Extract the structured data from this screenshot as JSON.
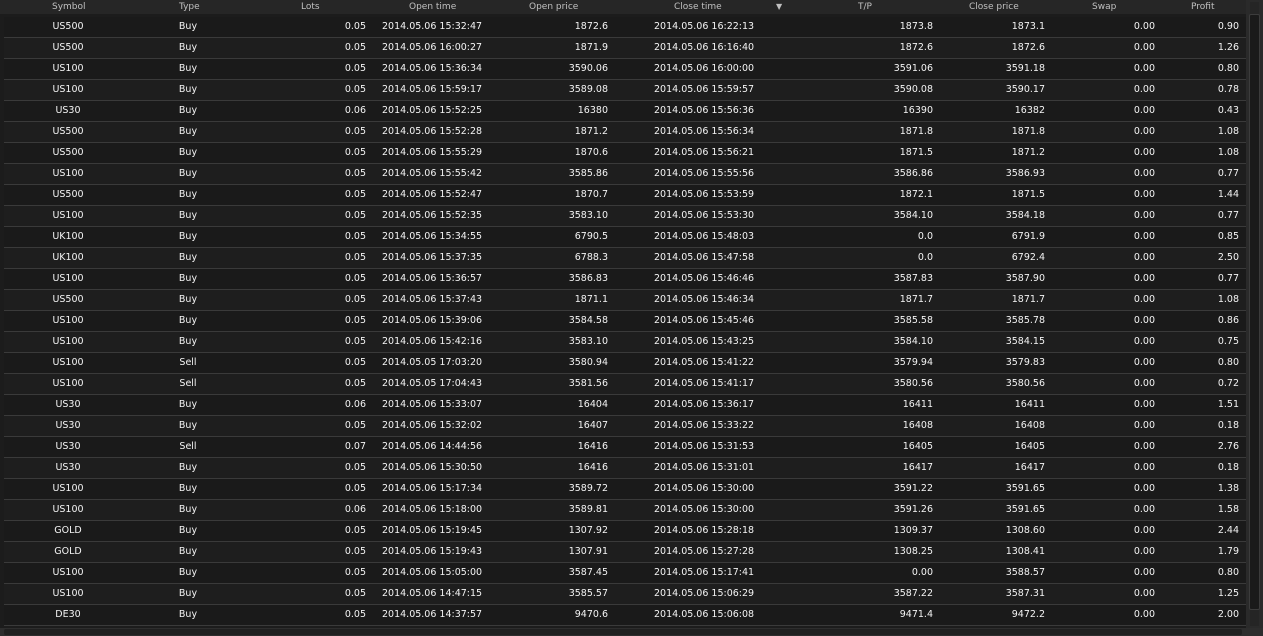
{
  "columns": {
    "symbol": "Symbol",
    "type": "Type",
    "lots": "Lots",
    "open_time": "Open time",
    "open_price": "Open price",
    "close_time": "Close time",
    "tp": "T/P",
    "close_price": "Close price",
    "swap": "Swap",
    "profit": "Profit"
  },
  "sort_indicator": "▼",
  "rows": [
    {
      "symbol": "US500",
      "type": "Buy",
      "lots": "0.05",
      "open_time": "2014.05.06 15:32:47",
      "open_price": "1872.6",
      "close_time": "2014.05.06 16:22:13",
      "tp": "1873.8",
      "close_price": "1873.1",
      "swap": "0.00",
      "profit": "0.90"
    },
    {
      "symbol": "US500",
      "type": "Buy",
      "lots": "0.05",
      "open_time": "2014.05.06 16:00:27",
      "open_price": "1871.9",
      "close_time": "2014.05.06 16:16:40",
      "tp": "1872.6",
      "close_price": "1872.6",
      "swap": "0.00",
      "profit": "1.26"
    },
    {
      "symbol": "US100",
      "type": "Buy",
      "lots": "0.05",
      "open_time": "2014.05.06 15:36:34",
      "open_price": "3590.06",
      "close_time": "2014.05.06 16:00:00",
      "tp": "3591.06",
      "close_price": "3591.18",
      "swap": "0.00",
      "profit": "0.80"
    },
    {
      "symbol": "US100",
      "type": "Buy",
      "lots": "0.05",
      "open_time": "2014.05.06 15:59:17",
      "open_price": "3589.08",
      "close_time": "2014.05.06 15:59:57",
      "tp": "3590.08",
      "close_price": "3590.17",
      "swap": "0.00",
      "profit": "0.78"
    },
    {
      "symbol": "US30",
      "type": "Buy",
      "lots": "0.06",
      "open_time": "2014.05.06 15:52:25",
      "open_price": "16380",
      "close_time": "2014.05.06 15:56:36",
      "tp": "16390",
      "close_price": "16382",
      "swap": "0.00",
      "profit": "0.43"
    },
    {
      "symbol": "US500",
      "type": "Buy",
      "lots": "0.05",
      "open_time": "2014.05.06 15:52:28",
      "open_price": "1871.2",
      "close_time": "2014.05.06 15:56:34",
      "tp": "1871.8",
      "close_price": "1871.8",
      "swap": "0.00",
      "profit": "1.08"
    },
    {
      "symbol": "US500",
      "type": "Buy",
      "lots": "0.05",
      "open_time": "2014.05.06 15:55:29",
      "open_price": "1870.6",
      "close_time": "2014.05.06 15:56:21",
      "tp": "1871.5",
      "close_price": "1871.2",
      "swap": "0.00",
      "profit": "1.08"
    },
    {
      "symbol": "US100",
      "type": "Buy",
      "lots": "0.05",
      "open_time": "2014.05.06 15:55:42",
      "open_price": "3585.86",
      "close_time": "2014.05.06 15:55:56",
      "tp": "3586.86",
      "close_price": "3586.93",
      "swap": "0.00",
      "profit": "0.77"
    },
    {
      "symbol": "US500",
      "type": "Buy",
      "lots": "0.05",
      "open_time": "2014.05.06 15:52:47",
      "open_price": "1870.7",
      "close_time": "2014.05.06 15:53:59",
      "tp": "1872.1",
      "close_price": "1871.5",
      "swap": "0.00",
      "profit": "1.44"
    },
    {
      "symbol": "US100",
      "type": "Buy",
      "lots": "0.05",
      "open_time": "2014.05.06 15:52:35",
      "open_price": "3583.10",
      "close_time": "2014.05.06 15:53:30",
      "tp": "3584.10",
      "close_price": "3584.18",
      "swap": "0.00",
      "profit": "0.77"
    },
    {
      "symbol": "UK100",
      "type": "Buy",
      "lots": "0.05",
      "open_time": "2014.05.06 15:34:55",
      "open_price": "6790.5",
      "close_time": "2014.05.06 15:48:03",
      "tp": "0.0",
      "close_price": "6791.9",
      "swap": "0.00",
      "profit": "0.85"
    },
    {
      "symbol": "UK100",
      "type": "Buy",
      "lots": "0.05",
      "open_time": "2014.05.06 15:37:35",
      "open_price": "6788.3",
      "close_time": "2014.05.06 15:47:58",
      "tp": "0.0",
      "close_price": "6792.4",
      "swap": "0.00",
      "profit": "2.50"
    },
    {
      "symbol": "US100",
      "type": "Buy",
      "lots": "0.05",
      "open_time": "2014.05.06 15:36:57",
      "open_price": "3586.83",
      "close_time": "2014.05.06 15:46:46",
      "tp": "3587.83",
      "close_price": "3587.90",
      "swap": "0.00",
      "profit": "0.77"
    },
    {
      "symbol": "US500",
      "type": "Buy",
      "lots": "0.05",
      "open_time": "2014.05.06 15:37:43",
      "open_price": "1871.1",
      "close_time": "2014.05.06 15:46:34",
      "tp": "1871.7",
      "close_price": "1871.7",
      "swap": "0.00",
      "profit": "1.08"
    },
    {
      "symbol": "US100",
      "type": "Buy",
      "lots": "0.05",
      "open_time": "2014.05.06 15:39:06",
      "open_price": "3584.58",
      "close_time": "2014.05.06 15:45:46",
      "tp": "3585.58",
      "close_price": "3585.78",
      "swap": "0.00",
      "profit": "0.86"
    },
    {
      "symbol": "US100",
      "type": "Buy",
      "lots": "0.05",
      "open_time": "2014.05.06 15:42:16",
      "open_price": "3583.10",
      "close_time": "2014.05.06 15:43:25",
      "tp": "3584.10",
      "close_price": "3584.15",
      "swap": "0.00",
      "profit": "0.75"
    },
    {
      "symbol": "US100",
      "type": "Sell",
      "lots": "0.05",
      "open_time": "2014.05.05 17:03:20",
      "open_price": "3580.94",
      "close_time": "2014.05.06 15:41:22",
      "tp": "3579.94",
      "close_price": "3579.83",
      "swap": "0.00",
      "profit": "0.80"
    },
    {
      "symbol": "US100",
      "type": "Sell",
      "lots": "0.05",
      "open_time": "2014.05.05 17:04:43",
      "open_price": "3581.56",
      "close_time": "2014.05.06 15:41:17",
      "tp": "3580.56",
      "close_price": "3580.56",
      "swap": "0.00",
      "profit": "0.72"
    },
    {
      "symbol": "US30",
      "type": "Buy",
      "lots": "0.06",
      "open_time": "2014.05.06 15:33:07",
      "open_price": "16404",
      "close_time": "2014.05.06 15:36:17",
      "tp": "16411",
      "close_price": "16411",
      "swap": "0.00",
      "profit": "1.51"
    },
    {
      "symbol": "US30",
      "type": "Buy",
      "lots": "0.05",
      "open_time": "2014.05.06 15:32:02",
      "open_price": "16407",
      "close_time": "2014.05.06 15:33:22",
      "tp": "16408",
      "close_price": "16408",
      "swap": "0.00",
      "profit": "0.18"
    },
    {
      "symbol": "US30",
      "type": "Sell",
      "lots": "0.07",
      "open_time": "2014.05.06 14:44:56",
      "open_price": "16416",
      "close_time": "2014.05.06 15:31:53",
      "tp": "16405",
      "close_price": "16405",
      "swap": "0.00",
      "profit": "2.76"
    },
    {
      "symbol": "US30",
      "type": "Buy",
      "lots": "0.05",
      "open_time": "2014.05.06 15:30:50",
      "open_price": "16416",
      "close_time": "2014.05.06 15:31:01",
      "tp": "16417",
      "close_price": "16417",
      "swap": "0.00",
      "profit": "0.18"
    },
    {
      "symbol": "US100",
      "type": "Buy",
      "lots": "0.05",
      "open_time": "2014.05.06 15:17:34",
      "open_price": "3589.72",
      "close_time": "2014.05.06 15:30:00",
      "tp": "3591.22",
      "close_price": "3591.65",
      "swap": "0.00",
      "profit": "1.38"
    },
    {
      "symbol": "US100",
      "type": "Buy",
      "lots": "0.06",
      "open_time": "2014.05.06 15:18:00",
      "open_price": "3589.81",
      "close_time": "2014.05.06 15:30:00",
      "tp": "3591.26",
      "close_price": "3591.65",
      "swap": "0.00",
      "profit": "1.58"
    },
    {
      "symbol": "GOLD",
      "type": "Buy",
      "lots": "0.05",
      "open_time": "2014.05.06 15:19:45",
      "open_price": "1307.92",
      "close_time": "2014.05.06 15:28:18",
      "tp": "1309.37",
      "close_price": "1308.60",
      "swap": "0.00",
      "profit": "2.44"
    },
    {
      "symbol": "GOLD",
      "type": "Buy",
      "lots": "0.05",
      "open_time": "2014.05.06 15:19:43",
      "open_price": "1307.91",
      "close_time": "2014.05.06 15:27:28",
      "tp": "1308.25",
      "close_price": "1308.41",
      "swap": "0.00",
      "profit": "1.79"
    },
    {
      "symbol": "US100",
      "type": "Buy",
      "lots": "0.05",
      "open_time": "2014.05.06 15:05:00",
      "open_price": "3587.45",
      "close_time": "2014.05.06 15:17:41",
      "tp": "0.00",
      "close_price": "3588.57",
      "swap": "0.00",
      "profit": "0.80"
    },
    {
      "symbol": "US100",
      "type": "Buy",
      "lots": "0.05",
      "open_time": "2014.05.06 14:47:15",
      "open_price": "3585.57",
      "close_time": "2014.05.06 15:06:29",
      "tp": "3587.22",
      "close_price": "3587.31",
      "swap": "0.00",
      "profit": "1.25"
    },
    {
      "symbol": "DE30",
      "type": "Buy",
      "lots": "0.05",
      "open_time": "2014.05.06 14:37:57",
      "open_price": "9470.6",
      "close_time": "2014.05.06 15:06:08",
      "tp": "9471.4",
      "close_price": "9472.2",
      "swap": "0.00",
      "profit": "2.00"
    }
  ]
}
